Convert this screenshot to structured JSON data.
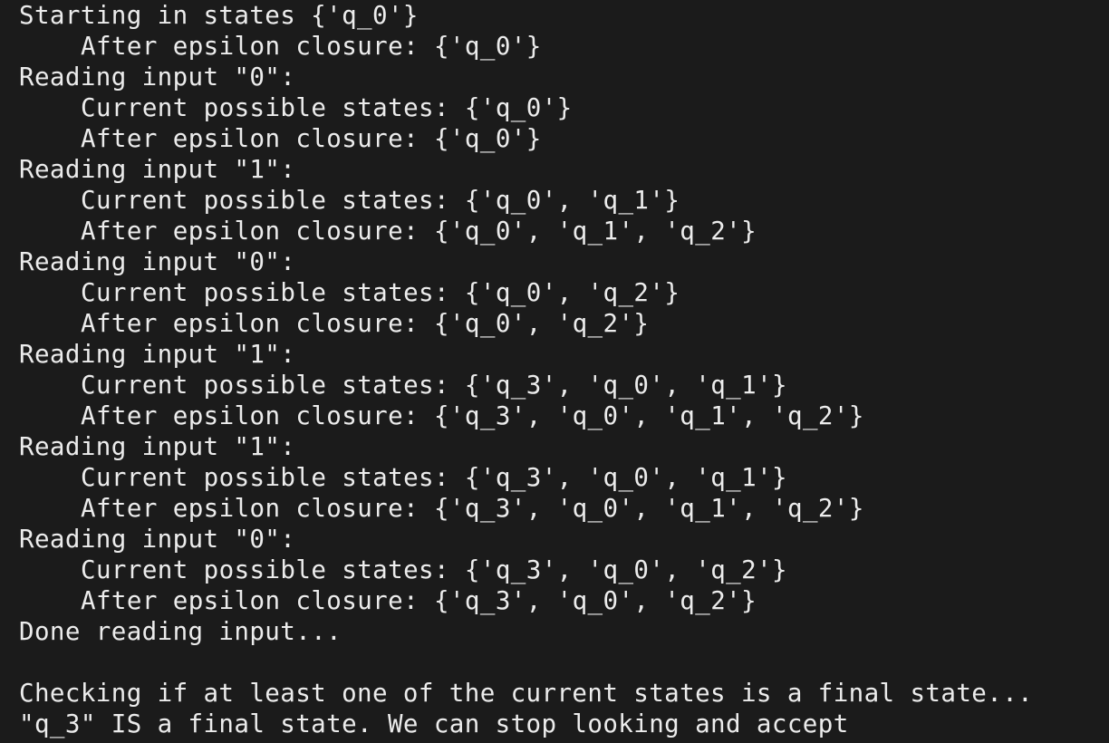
{
  "terminal": {
    "background": "#1b1b1b",
    "foreground": "#ececec",
    "lines": [
      {
        "text": "Starting in states {'q_0'}",
        "indent": false
      },
      {
        "text": "After epsilon closure: {'q_0'}",
        "indent": true
      },
      {
        "text": "Reading input \"0\":",
        "indent": false
      },
      {
        "text": "Current possible states: {'q_0'}",
        "indent": true
      },
      {
        "text": "After epsilon closure: {'q_0'}",
        "indent": true
      },
      {
        "text": "Reading input \"1\":",
        "indent": false
      },
      {
        "text": "Current possible states: {'q_0', 'q_1'}",
        "indent": true
      },
      {
        "text": "After epsilon closure: {'q_0', 'q_1', 'q_2'}",
        "indent": true
      },
      {
        "text": "Reading input \"0\":",
        "indent": false
      },
      {
        "text": "Current possible states: {'q_0', 'q_2'}",
        "indent": true
      },
      {
        "text": "After epsilon closure: {'q_0', 'q_2'}",
        "indent": true
      },
      {
        "text": "Reading input \"1\":",
        "indent": false
      },
      {
        "text": "Current possible states: {'q_3', 'q_0', 'q_1'}",
        "indent": true
      },
      {
        "text": "After epsilon closure: {'q_3', 'q_0', 'q_1', 'q_2'}",
        "indent": true
      },
      {
        "text": "Reading input \"1\":",
        "indent": false
      },
      {
        "text": "Current possible states: {'q_3', 'q_0', 'q_1'}",
        "indent": true
      },
      {
        "text": "After epsilon closure: {'q_3', 'q_0', 'q_1', 'q_2'}",
        "indent": true
      },
      {
        "text": "Reading input \"0\":",
        "indent": false
      },
      {
        "text": "Current possible states: {'q_3', 'q_0', 'q_2'}",
        "indent": true
      },
      {
        "text": "After epsilon closure: {'q_3', 'q_0', 'q_2'}",
        "indent": true
      },
      {
        "text": "Done reading input...",
        "indent": false
      },
      {
        "text": "",
        "indent": false
      },
      {
        "text": "Checking if at least one of the current states is a final state...",
        "indent": false
      },
      {
        "text": "\"q_3\" IS a final state. We can stop looking and accept",
        "indent": false
      }
    ]
  }
}
